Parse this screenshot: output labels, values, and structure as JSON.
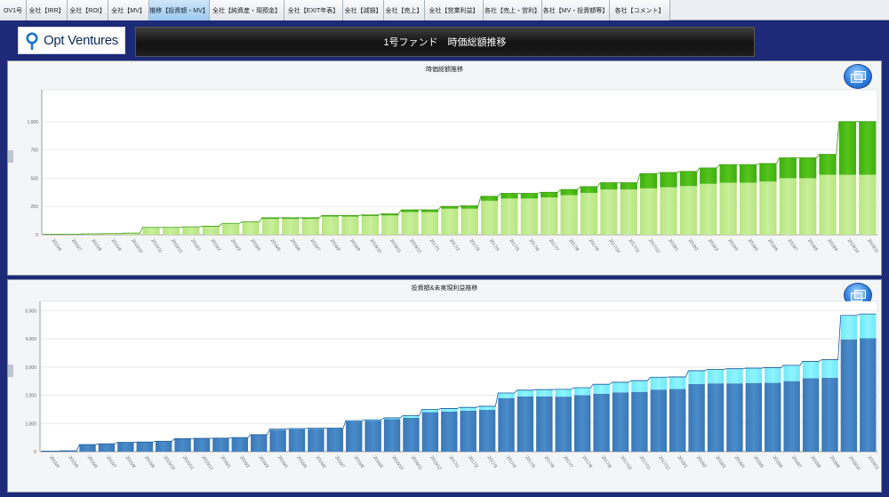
{
  "tabs": [
    {
      "label": "OV1号",
      "active": false
    },
    {
      "label": "全社【IRR】",
      "active": false
    },
    {
      "label": "全社【ROI】",
      "active": false
    },
    {
      "label": "全社【MV】",
      "active": false
    },
    {
      "label": "推移【投資額・MV】",
      "active": true
    },
    {
      "label": "全社【純資産・現預金】",
      "active": false
    },
    {
      "label": "全社【EXIT年表】",
      "active": false
    },
    {
      "label": "全社【減損】",
      "active": false
    },
    {
      "label": "全社【売上】",
      "active": false
    },
    {
      "label": "全社【営業利益】",
      "active": false
    },
    {
      "label": "各社【売上・営利】",
      "active": false
    },
    {
      "label": "各社【MV・投資額等】",
      "active": false
    },
    {
      "label": "各社【コメント】",
      "active": false
    }
  ],
  "logo": {
    "text": "Opt Ventures",
    "color": "#1a73d1"
  },
  "page_title": "1号ファンド　時価総額推移",
  "colors": {
    "green_light": "#c8ef9a",
    "green_dark": "#55c41c",
    "blue_dark": "#4a8bc9",
    "cyan_light": "#8ff4ff"
  },
  "chart_data": [
    {
      "type": "bar",
      "stacked": true,
      "title": "時価総額推移",
      "ylim": [
        0,
        1250
      ],
      "yticks": [
        "0",
        "250",
        "500",
        "750",
        "1,000"
      ],
      "grid": true,
      "categories": [
        "2015/6",
        "2015/7",
        "2015/8",
        "2015/9",
        "2015/10",
        "2015/11",
        "2015/12",
        "2016/1",
        "2016/2",
        "2016/3",
        "2016/4",
        "2016/5",
        "2016/6",
        "2016/7",
        "2016/8",
        "2016/9",
        "2016/10",
        "2016/11",
        "2016/12",
        "2017/1",
        "2017/2",
        "2017/3",
        "2017/4",
        "2017/5",
        "2017/6",
        "2017/7",
        "2017/8",
        "2017/9",
        "2017/10",
        "2017/11",
        "2017/12",
        "2018/1",
        "2018/2",
        "2018/3",
        "2018/4",
        "2018/5",
        "2018/6",
        "2018/7",
        "2018/8",
        "2018/9",
        "2018/10",
        "2018/11"
      ],
      "series": [
        {
          "values": [
            5,
            5,
            8,
            10,
            15,
            65,
            65,
            70,
            75,
            100,
            115,
            140,
            140,
            140,
            160,
            160,
            165,
            170,
            200,
            200,
            230,
            230,
            300,
            320,
            320,
            330,
            350,
            370,
            400,
            400,
            410,
            420,
            430,
            450,
            460,
            460,
            470,
            500,
            500,
            530,
            530,
            530
          ]
        },
        {
          "values": [
            0,
            0,
            0,
            0,
            0,
            0,
            0,
            0,
            0,
            0,
            0,
            10,
            10,
            10,
            10,
            10,
            10,
            15,
            20,
            20,
            20,
            25,
            40,
            45,
            45,
            45,
            50,
            55,
            60,
            60,
            130,
            130,
            130,
            140,
            160,
            160,
            160,
            180,
            180,
            180,
            470,
            470
          ]
        }
      ]
    },
    {
      "type": "bar",
      "stacked": true,
      "title": "投資額&未実現利益推移",
      "ylim": [
        0,
        5200
      ],
      "yticks": [
        "0",
        "1,000",
        "2,000",
        "3,000",
        "4,000",
        "5,000"
      ],
      "grid": true,
      "categories": [
        "2015/4",
        "2015/5",
        "2015/6",
        "2015/7",
        "2015/8",
        "2015/9",
        "2015/10",
        "2015/11",
        "2015/12",
        "2016/1",
        "2016/2",
        "2016/3",
        "2016/4",
        "2016/5",
        "2016/6",
        "2016/7",
        "2016/8",
        "2016/9",
        "2016/10",
        "2016/11",
        "2016/12",
        "2017/1",
        "2017/2",
        "2017/3",
        "2017/4",
        "2017/5",
        "2017/6",
        "2017/7",
        "2017/8",
        "2017/9",
        "2017/10",
        "2017/11",
        "2017/12",
        "2018/1",
        "2018/2",
        "2018/3",
        "2018/4",
        "2018/5",
        "2018/6",
        "2018/7",
        "2018/8",
        "2018/9",
        "2018/10",
        "2018/11"
      ],
      "series": [
        {
          "values": [
            20,
            30,
            250,
            280,
            330,
            340,
            370,
            460,
            470,
            480,
            500,
            600,
            780,
            800,
            810,
            820,
            1080,
            1100,
            1150,
            1200,
            1400,
            1420,
            1450,
            1480,
            1900,
            1960,
            1960,
            1950,
            2000,
            2050,
            2100,
            2120,
            2200,
            2220,
            2400,
            2420,
            2420,
            2430,
            2440,
            2500,
            2600,
            2620,
            3980,
            4020
          ]
        },
        {
          "values": [
            0,
            0,
            0,
            0,
            0,
            0,
            0,
            0,
            0,
            0,
            0,
            0,
            20,
            20,
            20,
            20,
            20,
            30,
            50,
            80,
            100,
            110,
            120,
            130,
            180,
            220,
            240,
            260,
            270,
            340,
            360,
            400,
            440,
            430,
            470,
            500,
            520,
            530,
            540,
            560,
            600,
            640,
            850,
            860
          ]
        }
      ]
    }
  ]
}
